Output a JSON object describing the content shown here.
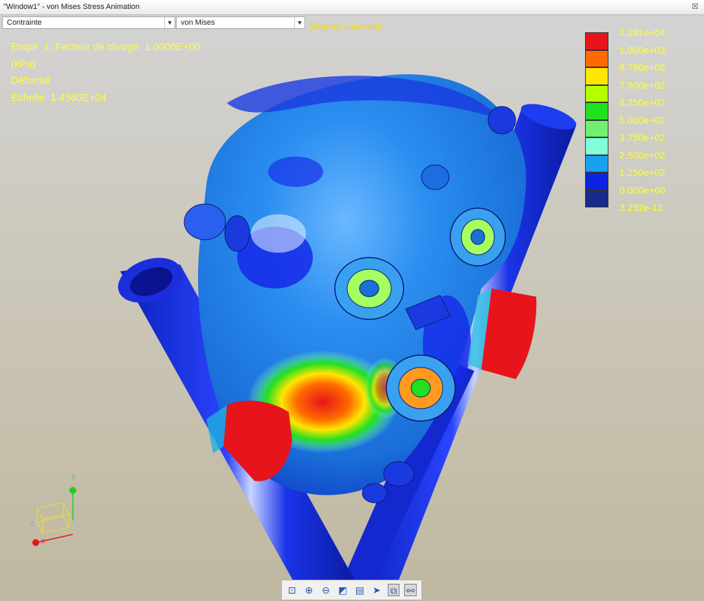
{
  "window": {
    "title": "\"Window1\" - von Mises Stress Animation",
    "close_icon": "close-icon"
  },
  "controls": {
    "result_type": "Contrainte",
    "component": "von Mises",
    "frame_label": "(Repère universel)"
  },
  "info": {
    "step_line": "Etape  1, Facteur de charge  1.0000E+00",
    "unit": "(kPa)",
    "display_mode": "Déformé",
    "scale_line": "Echelle  1.4560E+04"
  },
  "legend": {
    "labels": [
      "1.281e+04",
      "1.000e+03",
      "8.750e+02",
      "7.500e+02",
      "6.250e+02",
      "5.000e+02",
      "3.750e+02",
      "2.500e+02",
      "1.250e+02",
      "0.000e+00"
    ],
    "min_label": "3.292e-12",
    "colors": [
      "#e8141c",
      "#ff6a00",
      "#ffe600",
      "#b4ff00",
      "#20e020",
      "#70f070",
      "#80ffd8",
      "#1aa0f0",
      "#0a24e0",
      "#1a2a8a"
    ]
  },
  "triad": {
    "y_label": "Y",
    "z_label": "Z",
    "x_label": "X",
    "colors": {
      "y": "#22cc22",
      "x": "#e8141c",
      "box": "#e8e030"
    }
  },
  "toolbar": {
    "buttons": [
      {
        "icon": "zoom-fit-icon",
        "glyph": "⊡"
      },
      {
        "icon": "zoom-in-icon",
        "glyph": "⊕"
      },
      {
        "icon": "zoom-out-icon",
        "glyph": "⊖"
      },
      {
        "icon": "shaded-view-icon",
        "glyph": "◩"
      },
      {
        "icon": "view-options-icon",
        "glyph": "▤"
      },
      {
        "icon": "animate-icon",
        "glyph": "➤"
      },
      {
        "icon": "deformed-toggle-icon",
        "glyph": "⧉"
      },
      {
        "icon": "probe-icon",
        "glyph": "⚯"
      }
    ]
  }
}
